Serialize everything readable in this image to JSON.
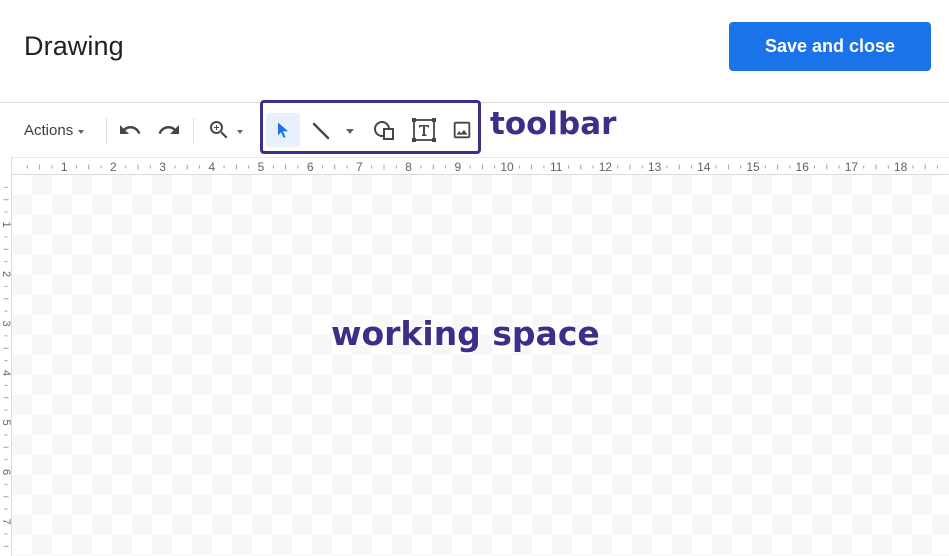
{
  "header": {
    "title": "Drawing",
    "save_label": "Save and close"
  },
  "toolbar": {
    "actions_label": "Actions",
    "icons": [
      "undo-icon",
      "redo-icon",
      "zoom-icon",
      "select-icon",
      "line-icon",
      "shape-icon",
      "text-box-icon",
      "image-icon"
    ]
  },
  "ruler": {
    "horizontal_labels": [
      "1",
      "2",
      "3",
      "4",
      "5",
      "6",
      "7",
      "8",
      "9",
      "10",
      "11",
      "12",
      "13",
      "14",
      "15",
      "16",
      "17",
      "18"
    ],
    "vertical_labels": [
      "1",
      "2",
      "3",
      "4",
      "5",
      "6",
      "7"
    ]
  },
  "annotations": {
    "toolbar_label": "toolbar",
    "working_space_label": "working space"
  },
  "colors": {
    "accent": "#1a73e8",
    "annotation": "#3b2f87",
    "selected_tool_bg": "#e8f0fe"
  }
}
